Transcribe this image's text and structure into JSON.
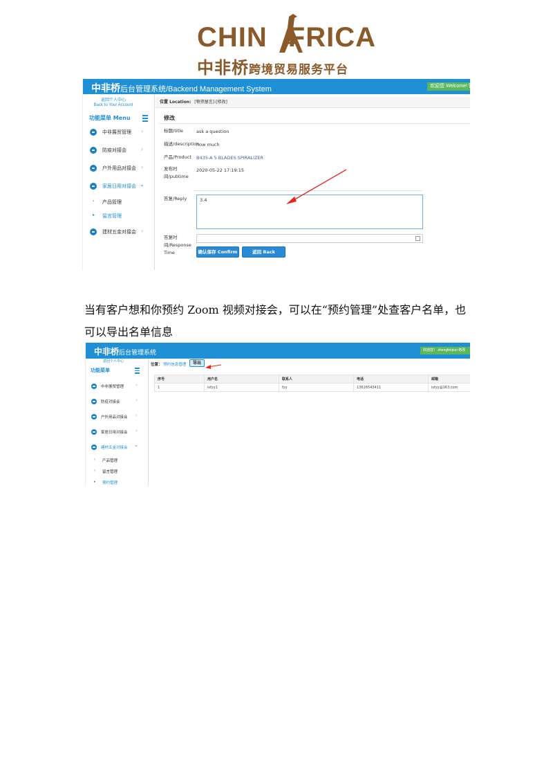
{
  "logo": {
    "word": "CHIN AFRICA",
    "word_left": "CHIN",
    "word_right": "FRICA",
    "subtitle_big": "中非桥",
    "subtitle_rest": "跨境贸易服务平台",
    "color": "#8a5a2b"
  },
  "screenshot1": {
    "brand_bold": "中非桥",
    "brand_rest": "后台管理系统/Backend Management System",
    "welcome": "欢迎您 Welcome! 管",
    "back_link_line1": "返回个人中心",
    "back_link_line2": "Back to Your Account",
    "menu_head": "功能菜单 Menu",
    "menu_items": [
      {
        "label": "中非展贸管理",
        "open": false
      },
      {
        "label": "防疫对接会",
        "open": false
      },
      {
        "label": "户外用品对接会",
        "open": false
      },
      {
        "label": "家居日用对接会",
        "open": true
      },
      {
        "label": "建材五金对接会",
        "open": false
      }
    ],
    "sub_items": [
      {
        "label": "产品管理",
        "active": false
      },
      {
        "label": "留言管理",
        "active": true
      }
    ],
    "crumb_label": "位置 Location:",
    "crumb_value": "[物资留言]-[修改]",
    "tab": "修改",
    "fields": {
      "title_label": "标题/title",
      "title_value": "ask a question",
      "description_label": "描述/description",
      "description_value": "how much",
      "product_label": "产品/Product",
      "product_value": "B435-A 5 BLADES SPIRALIZER",
      "pubtime_label_1": "发布时",
      "pubtime_label_2": "间/pubtime",
      "pubtime_value": "2020-05-22 17:19:15",
      "reply_label": "答复/Reply",
      "reply_value": "3.4",
      "response_label_1": "答复时",
      "response_label_2": "间/Response",
      "response_label_3": "Time"
    },
    "buttons": {
      "confirm": "确认保存 Confirm",
      "back": "返回 Back"
    },
    "arrow_color": "#e8241c"
  },
  "paragraph": {
    "line1": "当有客户想和你预约 Zoom 视频对接会，可以在“预约管理”处查客户名单，也",
    "line2": "可以导出名单信息"
  },
  "screenshot2": {
    "brand_bold": "中非桥",
    "brand_rest": "后台管理系统",
    "welcome": "欢迎您！ zhongfeiqiao 修改",
    "back_link": "返回个人中心",
    "menu_head": "功能菜单",
    "menu_items": [
      {
        "label": "中非展贸管理",
        "open": false
      },
      {
        "label": "防疫对接会",
        "open": false
      },
      {
        "label": "户外用品对接会",
        "open": false
      },
      {
        "label": "家居日用对接会",
        "open": false
      },
      {
        "label": "建材五金对接会",
        "open": true
      }
    ],
    "sub_items": [
      {
        "label": "产品管理",
        "active": false
      },
      {
        "label": "留言管理",
        "active": false
      },
      {
        "label": "预约管理",
        "active": true
      }
    ],
    "crumb_label": "位置：",
    "crumb_value": "预约信息管理",
    "export_button": "导出",
    "table": {
      "headers": [
        "序号",
        "用户名",
        "联系人",
        "电话",
        "邮箱"
      ],
      "rows": [
        [
          "1",
          "isfyy1",
          "fyy",
          "13616543411",
          "isfyy@163.com"
        ]
      ]
    }
  }
}
